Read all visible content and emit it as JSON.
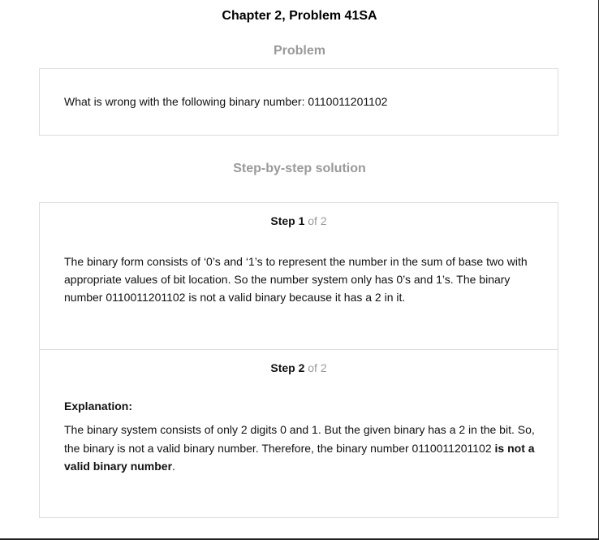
{
  "page": {
    "chapter_title": "Chapter 2, Problem 41SA"
  },
  "problem": {
    "heading": "Problem",
    "text": "What is wrong with the following binary number: 0110011201102"
  },
  "solution": {
    "heading": "Step-by-step solution",
    "steps": [
      {
        "label": "Step 1",
        "of_text": " of 2",
        "body": "The binary form consists of ‘0’s and ‘1’s to represent the number in the sum of base two with appropriate values of bit location. So the number system only has 0’s and 1’s. The binary number 0110011201102 is not a valid binary because it has a 2 in it."
      },
      {
        "label": "Step 2",
        "of_text": " of 2",
        "explanation_label": "Explanation:",
        "body_prefix": "The binary system consists of only 2 digits 0 and 1. But the given binary has a 2 in the bit. So, the binary is not a valid binary number. Therefore, the binary number 0110011201102 ",
        "body_bold": "is not a valid binary number",
        "body_suffix": "."
      }
    ]
  }
}
